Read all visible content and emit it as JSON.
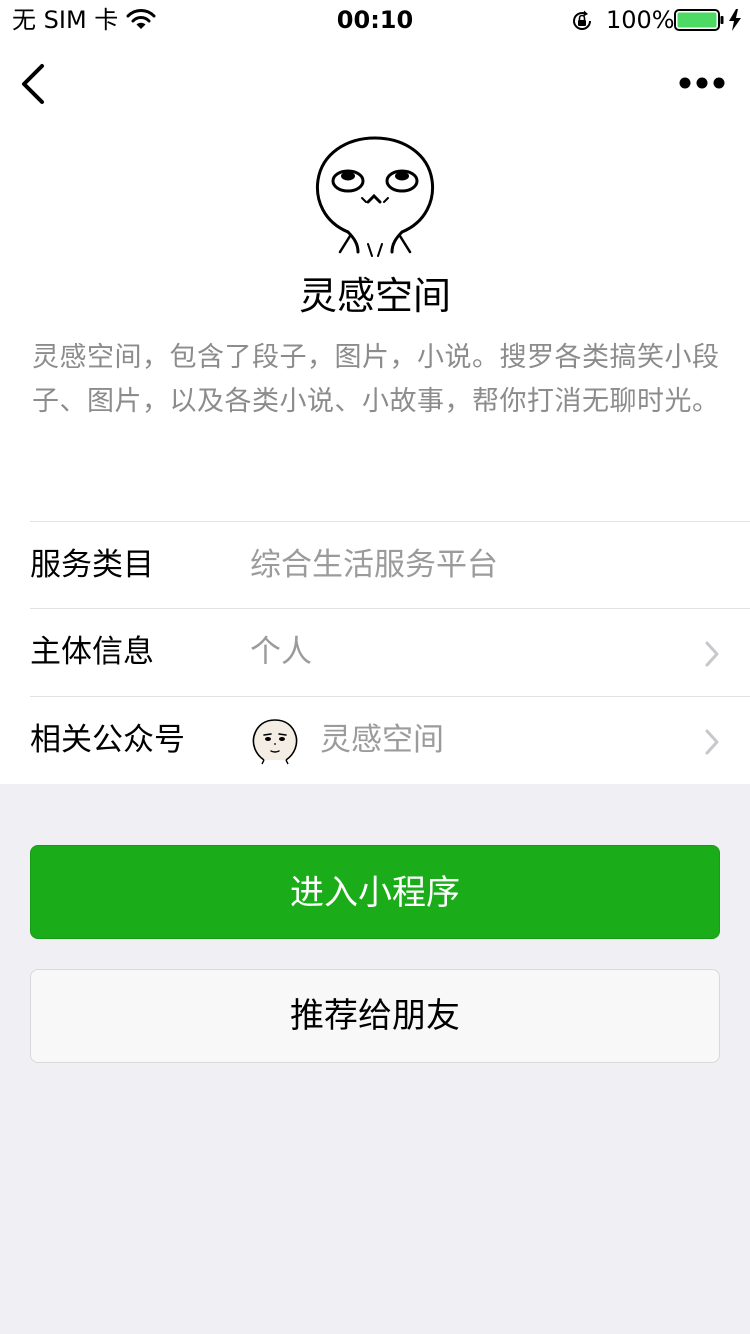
{
  "status_bar": {
    "carrier": "无 SIM 卡",
    "time": "00:10",
    "battery_percent": "100%",
    "battery_level": 1.0,
    "icons": [
      "wifi-icon",
      "rotation-lock-icon",
      "battery-icon",
      "charging-bolt-icon"
    ]
  },
  "nav": {
    "icons": [
      "back-chevron-icon",
      "more-dots-icon"
    ]
  },
  "profile": {
    "name": "灵感空间",
    "description": "灵感空间，包含了段子，图片，小说。搜罗各类搞笑小段子、图片，以及各类小说、小故事，帮你打消无聊时光。"
  },
  "info_rows": [
    {
      "label": "服务类目",
      "value": "综合生活服务平台"
    },
    {
      "label": "主体信息",
      "value": "个人"
    },
    {
      "label": "相关公众号",
      "value": "灵感空间"
    }
  ],
  "buttons": {
    "enter": "进入小程序",
    "recommend": "推荐给朋友"
  },
  "colors": {
    "primary_green": "#1aad19",
    "background": "#efeff4",
    "secondary_text": "#8c8c8c",
    "battery_fill": "#4cd964"
  }
}
